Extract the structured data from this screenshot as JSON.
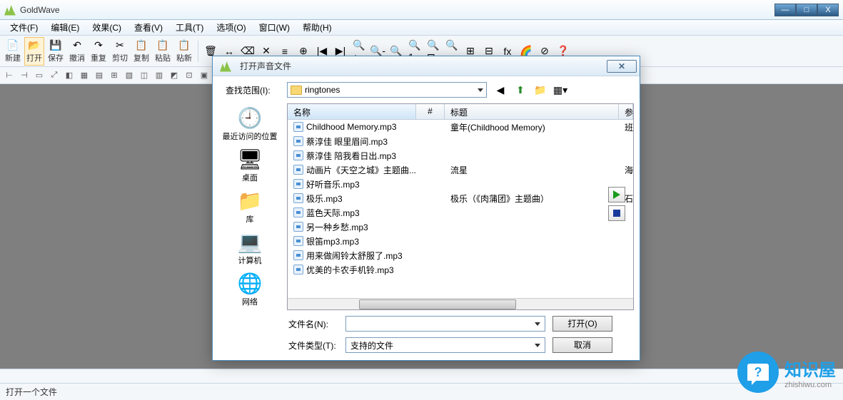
{
  "app": {
    "title": "GoldWave"
  },
  "menus": [
    "文件(F)",
    "编辑(E)",
    "效果(C)",
    "查看(V)",
    "工具(T)",
    "选项(O)",
    "窗口(W)",
    "帮助(H)"
  ],
  "toolbar_main": [
    {
      "label": "新建",
      "icon": "📄"
    },
    {
      "label": "打开",
      "icon": "📂",
      "active": true
    },
    {
      "label": "保存",
      "icon": "💾"
    },
    {
      "label": "撤消",
      "icon": "↶"
    },
    {
      "label": "重复",
      "icon": "↷"
    },
    {
      "label": "剪切",
      "icon": "✂"
    },
    {
      "label": "复制",
      "icon": "📋"
    },
    {
      "label": "粘贴",
      "icon": "📋"
    },
    {
      "label": "粘新",
      "icon": "📋"
    }
  ],
  "status_text": "打开一个文件",
  "dialog": {
    "title": "打开声音文件",
    "lookin_label": "查找范围(I):",
    "lookin_value": "ringtones",
    "columns": {
      "name": "名称",
      "num": "#",
      "title": "标题",
      "extra": "参"
    },
    "files": [
      {
        "name": "Childhood Memory.mp3",
        "title": "童年(Childhood Memory)",
        "extra": "班"
      },
      {
        "name": "蔡淳佳  眼里眉间.mp3",
        "title": "",
        "extra": ""
      },
      {
        "name": "蔡淳佳 陪我看日出.mp3",
        "title": "",
        "extra": ""
      },
      {
        "name": "动画片《天空之城》主题曲...",
        "title": "流星",
        "extra": "海"
      },
      {
        "name": "好听音乐.mp3",
        "title": "",
        "extra": ""
      },
      {
        "name": "极乐.mp3",
        "title": "极乐（《肉蒲团》主题曲）",
        "extra": "石"
      },
      {
        "name": "蓝色天际.mp3",
        "title": "",
        "extra": ""
      },
      {
        "name": "另一种乡愁.mp3",
        "title": "",
        "extra": ""
      },
      {
        "name": "银笛mp3.mp3",
        "title": "",
        "extra": ""
      },
      {
        "name": "用来做闹铃太舒服了.mp3",
        "title": "",
        "extra": ""
      },
      {
        "name": "优美的卡农手机铃.mp3",
        "title": "",
        "extra": ""
      }
    ],
    "filename_label": "文件名(N):",
    "filename_value": "",
    "filetype_label": "文件类型(T):",
    "filetype_value": "支持的文件",
    "open_btn": "打开(O)",
    "cancel_btn": "取消",
    "places": [
      {
        "label": "最近访问的位置",
        "icon": "🕘"
      },
      {
        "label": "桌面",
        "icon": "🖥"
      },
      {
        "label": "库",
        "icon": "📁"
      },
      {
        "label": "计算机",
        "icon": "💻"
      },
      {
        "label": "网络",
        "icon": "🌐"
      }
    ]
  },
  "watermark": {
    "main": "知识屋",
    "sub": "zhishiwu.com"
  }
}
